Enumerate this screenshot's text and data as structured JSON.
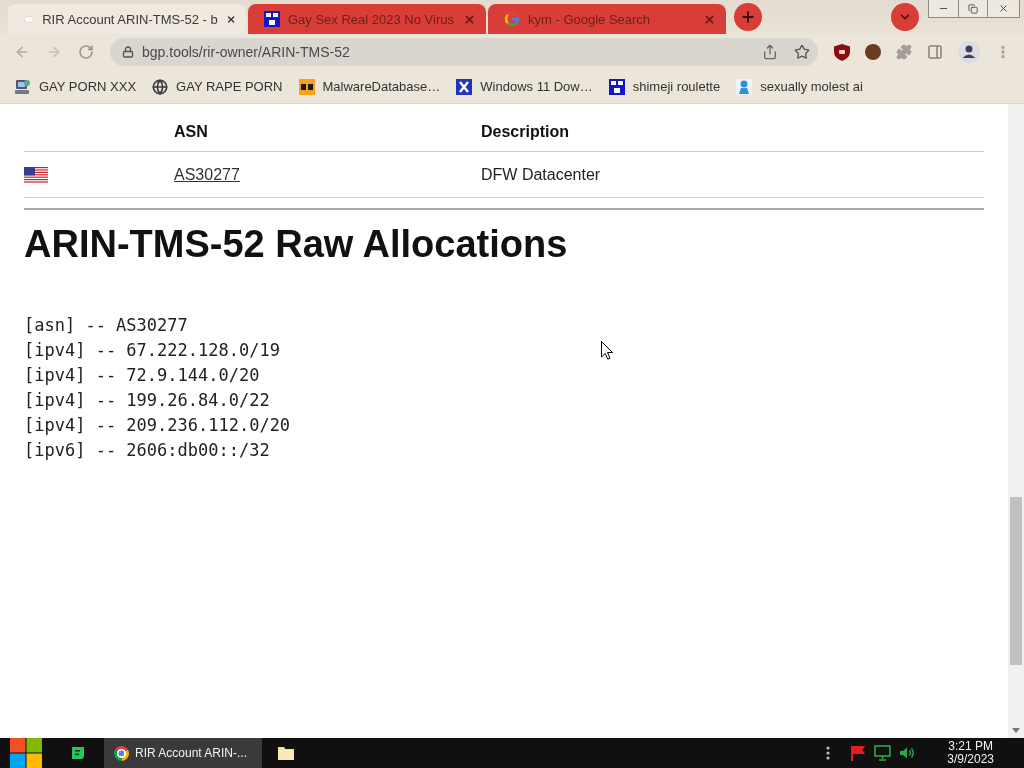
{
  "tabs": [
    {
      "title": "RIR Account ARIN-TMS-52 - b",
      "kind": "blob",
      "selected": true
    },
    {
      "title": "Gay Sex Real 2023 No Virus",
      "kind": "blue-tile",
      "selected": false
    },
    {
      "title": "kym - Google Search",
      "kind": "g",
      "selected": false
    }
  ],
  "address_bar": {
    "url": "bgp.tools/rir-owner/ARIN-TMS-52"
  },
  "bookmarks": [
    {
      "label": "GAY PORN XXX",
      "kind": "computer"
    },
    {
      "label": "GAY RAPE PORN",
      "kind": "globe"
    },
    {
      "label": "MalwareDatabase…",
      "kind": "orange-tile"
    },
    {
      "label": "Windows 11 Dow…",
      "kind": "x-tile"
    },
    {
      "label": "shimeji roulette",
      "kind": "blue-tile"
    },
    {
      "label": "sexually molest ai",
      "kind": "figure"
    }
  ],
  "table": {
    "columns": [
      "ASN",
      "Description"
    ],
    "rows": [
      {
        "asn": "AS30277",
        "description": "DFW Datacenter"
      }
    ]
  },
  "heading": "ARIN-TMS-52 Raw Allocations",
  "allocations": [
    "[asn] -- AS30277",
    "[ipv4] -- 67.222.128.0/19",
    "[ipv4] -- 72.9.144.0/20",
    "[ipv4] -- 199.26.84.0/22",
    "[ipv4] -- 209.236.112.0/20",
    "[ipv6] -- 2606:db00::/32"
  ],
  "taskbar": {
    "apps": [
      {
        "kind": "chat",
        "selected": false
      },
      {
        "kind": "browser",
        "label": "RIR Account ARIN-...",
        "selected": true
      },
      {
        "kind": "folder",
        "selected": false
      }
    ],
    "clock": {
      "time": "3:21 PM",
      "date": "3/9/2023"
    }
  }
}
